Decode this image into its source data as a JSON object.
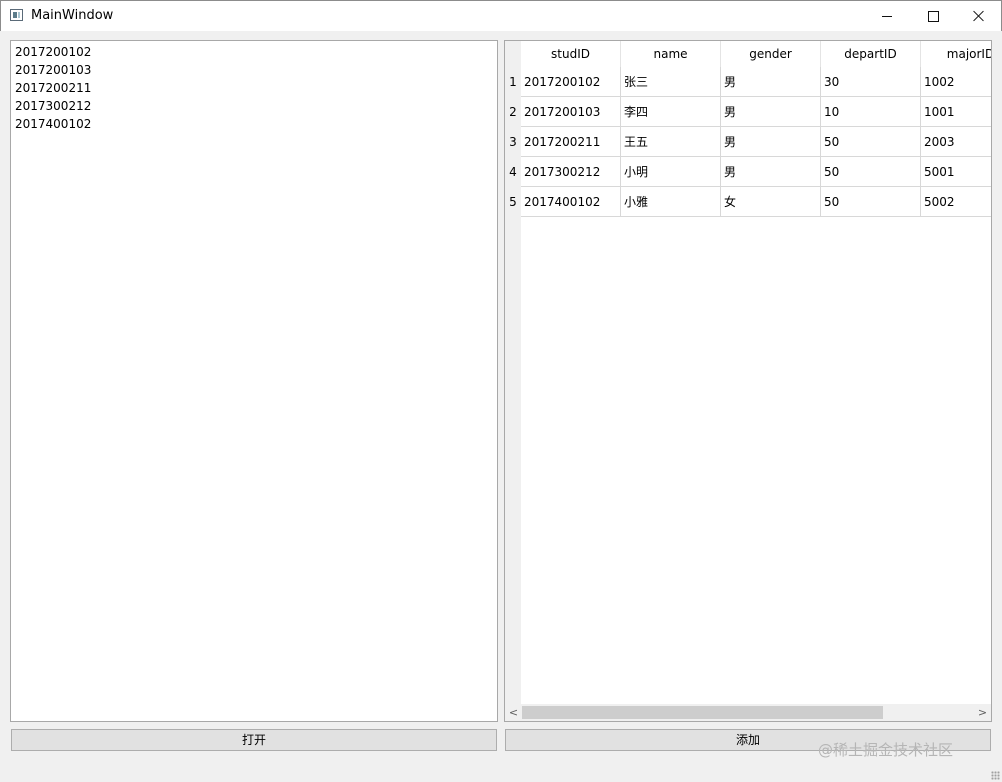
{
  "window": {
    "title": "MainWindow",
    "icon": "app-window-icon",
    "controls": [
      "minimize-icon",
      "maximize-icon",
      "close-icon"
    ]
  },
  "list": {
    "items": [
      "2017200102",
      "2017200103",
      "2017200211",
      "2017300212",
      "2017400102"
    ]
  },
  "table": {
    "columns": [
      "studID",
      "name",
      "gender",
      "departID",
      "majorID"
    ],
    "row_headers": [
      "1",
      "2",
      "3",
      "4",
      "5"
    ],
    "rows": [
      [
        "2017200102",
        "张三",
        "男",
        "30",
        "1002"
      ],
      [
        "2017200103",
        "李四",
        "男",
        "10",
        "1001"
      ],
      [
        "2017200211",
        "王五",
        "男",
        "50",
        "2003"
      ],
      [
        "2017300212",
        "小明",
        "男",
        "50",
        "5001"
      ],
      [
        "2017400102",
        "小雅",
        "女",
        "50",
        "5002"
      ]
    ],
    "scroll_left_glyph": "<",
    "scroll_right_glyph": ">"
  },
  "buttons": {
    "open_label": "打开",
    "add_label": "添加"
  },
  "watermark": "@稀土掘金技术社区"
}
